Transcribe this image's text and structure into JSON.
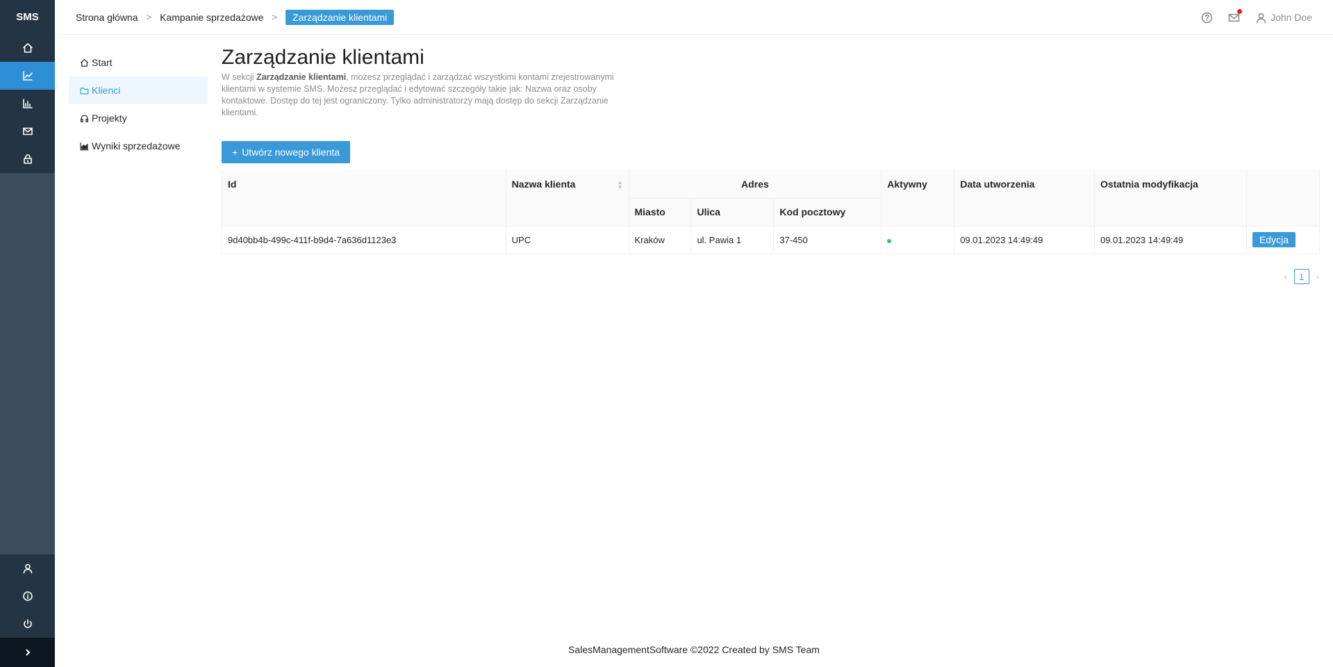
{
  "app": {
    "logo": "SMS"
  },
  "rail": {
    "items": [
      {
        "icon": "home-icon"
      },
      {
        "icon": "line-chart-icon",
        "active": true
      },
      {
        "icon": "bar-chart-icon"
      },
      {
        "icon": "mail-icon"
      },
      {
        "icon": "lock-icon"
      }
    ],
    "bottom": [
      {
        "icon": "user-icon"
      },
      {
        "icon": "info-icon"
      },
      {
        "icon": "power-icon"
      }
    ],
    "expand_icon": "chevron-right-icon"
  },
  "breadcrumb": {
    "items": [
      "Strona główna",
      "Kampanie sprzedażowe"
    ],
    "current": "Zarządzanie klientami",
    "separator": ">"
  },
  "header": {
    "user_name": "John Doe"
  },
  "menu": {
    "items": [
      {
        "label": "Start",
        "icon": "home-icon"
      },
      {
        "label": "Klienci",
        "icon": "folder-icon",
        "active": true
      },
      {
        "label": "Projekty",
        "icon": "headphones-icon"
      },
      {
        "label": "Wyniki sprzedażowe",
        "icon": "area-chart-icon"
      }
    ]
  },
  "main": {
    "title": "Zarządzanie klientami",
    "intro_prefix": "W sekcji ",
    "intro_bold": "Zarządzanie klientami",
    "intro_rest": ", możesz przeglądać i zarządzać wszystkimi kontami zrejestrowanymi klientami w systemie SMS. Możesz przeglądać i edytować szczegóły takie jak: Nazwa oraz osoby kontaktowe. Dostęp do tej jest ograniczony. Tylko administratorzy mają dostęp do sekcji Zarządzanie klientami.",
    "create_button": "Utwórz nowego klienta"
  },
  "table": {
    "headers": {
      "id": "Id",
      "name": "Nazwa klienta",
      "address": "Adres",
      "city": "Miasto",
      "street": "Ulica",
      "postal": "Kod pocztowy",
      "active": "Aktywny",
      "created": "Data utworzenia",
      "modified": "Ostatnia modyfikacja"
    },
    "rows": [
      {
        "id": "9d40bb4b-499c-411f-b9d4-7a636d1123e3",
        "name": "UPC",
        "city": "Kraków",
        "street": "ul. Pawia 1",
        "postal": "37-450",
        "active": true,
        "created": "09.01.2023 14:49:49",
        "modified": "09.01.2023 14:49:49",
        "action": "Edycja"
      }
    ]
  },
  "pagination": {
    "current": "1"
  },
  "footer": {
    "text": "SalesManagementSoftware ©2022 Created by SMS Team"
  },
  "colors": {
    "accent": "#3a99d8",
    "rail": "#3d4c5c",
    "rail_dark": "#243444",
    "active_dot": "#34c26b"
  }
}
